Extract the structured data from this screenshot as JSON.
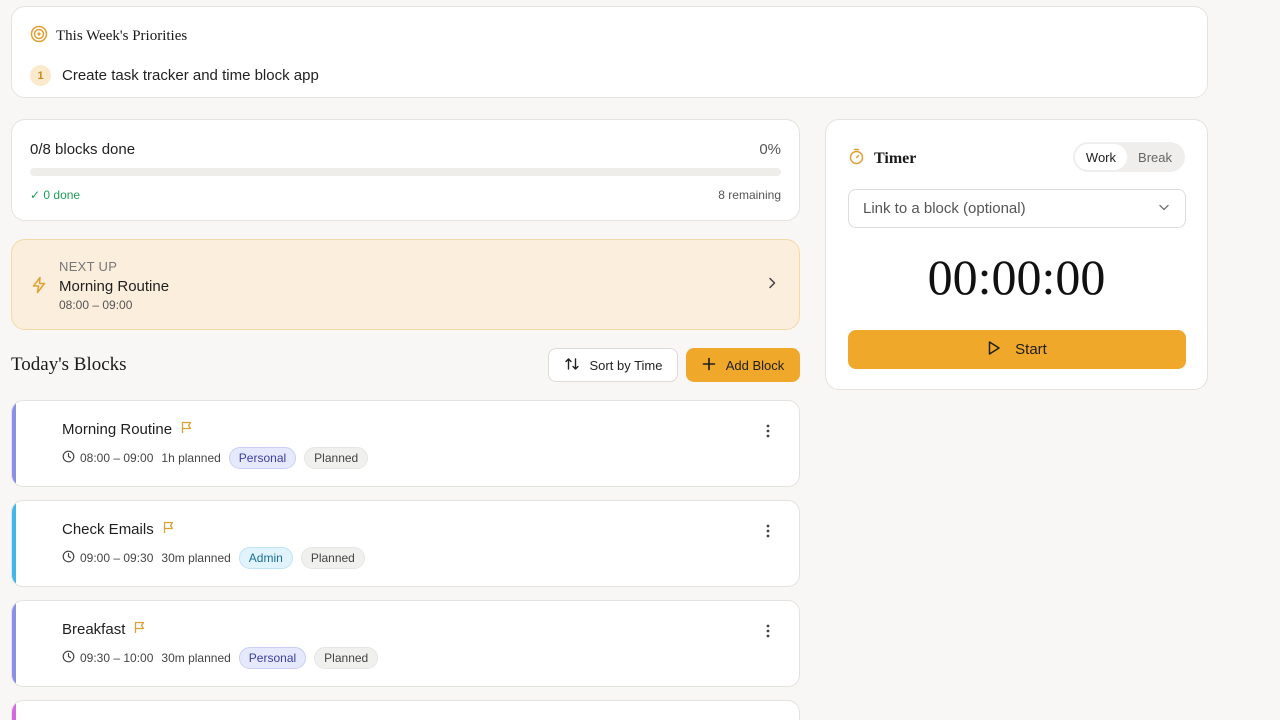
{
  "priorities": {
    "title": "This Week's Priorities",
    "items": [
      {
        "num": "1",
        "text": "Create task tracker and time block app"
      }
    ]
  },
  "progress": {
    "label": "0/8 blocks done",
    "percent_label": "0%",
    "fraction": 0,
    "done": "✓ 0 done",
    "remaining": "8 remaining"
  },
  "next_up": {
    "kicker": "NEXT UP",
    "title": "Morning Routine",
    "time": "08:00 – 09:00"
  },
  "blocks_section": {
    "title": "Today's Blocks",
    "sort_label": "Sort by Time",
    "add_label": "Add Block"
  },
  "blocks": [
    {
      "name": "Morning Routine",
      "time": "08:00 – 09:00",
      "planned": "1h planned",
      "category": "Personal",
      "status": "Planned",
      "color": "#8b8fe8"
    },
    {
      "name": "Check Emails",
      "time": "09:00 – 09:30",
      "planned": "30m planned",
      "category": "Admin",
      "status": "Planned",
      "color": "#3fb7e8"
    },
    {
      "name": "Breakfast",
      "time": "09:30 – 10:00",
      "planned": "30m planned",
      "category": "Personal",
      "status": "Planned",
      "color": "#8b8fe8"
    },
    {
      "name": "",
      "time": "",
      "planned": "",
      "category": "",
      "status": "",
      "color": "#d46ae0"
    }
  ],
  "timer": {
    "title": "Timer",
    "mode_work": "Work",
    "mode_break": "Break",
    "link_placeholder": "Link to a block (optional)",
    "display": "00:00:00",
    "start_label": "Start"
  },
  "colors": {
    "accent": "#f0a82a",
    "success": "#1f9d55"
  },
  "icons": {
    "priorities": "target-icon",
    "next_up": "lightning-icon",
    "timer": "stopwatch-icon",
    "sort": "sort-arrows-icon",
    "add": "plus-icon",
    "flag": "flag-icon",
    "clock": "clock-icon",
    "menu": "more-vertical-icon",
    "chevron": "chevron-down-icon",
    "play": "play-icon"
  }
}
